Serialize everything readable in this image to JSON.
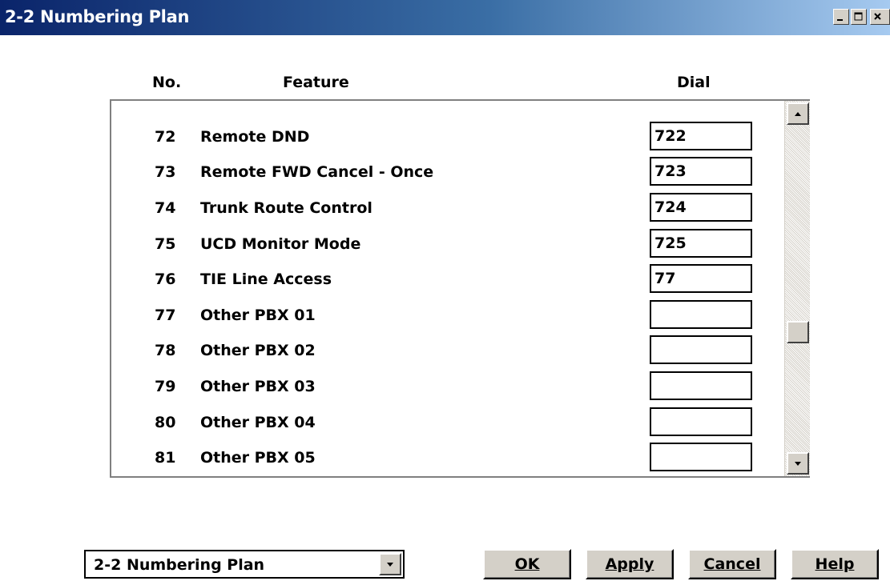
{
  "window": {
    "title": "2-2 Numbering Plan",
    "min_icon": "minimize-icon",
    "max_icon": "maximize-icon",
    "close_icon": "close-icon"
  },
  "headers": {
    "no": "No.",
    "feature": "Feature",
    "dial": "Dial"
  },
  "rows": [
    {
      "no": "72",
      "feature": "Remote DND",
      "dial": "722"
    },
    {
      "no": "73",
      "feature": "Remote FWD Cancel - Once",
      "dial": "723"
    },
    {
      "no": "74",
      "feature": "Trunk Route Control",
      "dial": "724"
    },
    {
      "no": "75",
      "feature": "UCD Monitor Mode",
      "dial": "725"
    },
    {
      "no": "76",
      "feature": "TIE Line Access",
      "dial": "77"
    },
    {
      "no": "77",
      "feature": "Other PBX 01",
      "dial": ""
    },
    {
      "no": "78",
      "feature": "Other PBX 02",
      "dial": ""
    },
    {
      "no": "79",
      "feature": "Other PBX 03",
      "dial": ""
    },
    {
      "no": "80",
      "feature": "Other PBX 04",
      "dial": ""
    },
    {
      "no": "81",
      "feature": "Other PBX 05",
      "dial": ""
    }
  ],
  "scrollbar": {
    "up_icon": "scroll-up-arrow-icon",
    "down_icon": "scroll-down-arrow-icon"
  },
  "footer": {
    "page_select": "2-2 Numbering Plan",
    "ok": "OK",
    "apply": "Apply",
    "cancel": "Cancel",
    "help": "Help"
  },
  "colors": {
    "title_bar_start": "#0a246a",
    "title_bar_end": "#a6caf0",
    "button_face": "#d4d0c8"
  }
}
